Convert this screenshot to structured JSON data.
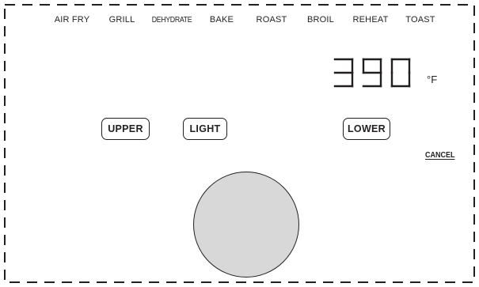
{
  "modes": [
    "AIR FRY",
    "GRILL",
    "DEHYDRATE",
    "BAKE",
    "ROAST",
    "BROIL",
    "REHEAT",
    "TOAST"
  ],
  "display": {
    "digits": [
      "3",
      "9",
      "0"
    ],
    "unit": "°F"
  },
  "buttons": {
    "upper": "UPPER",
    "light": "LIGHT",
    "lower": "LOWER"
  },
  "cancel": "CANCEL",
  "colors": {
    "ink": "#231f20",
    "knob": "#d8d8d8",
    "background": "#ffffff"
  }
}
